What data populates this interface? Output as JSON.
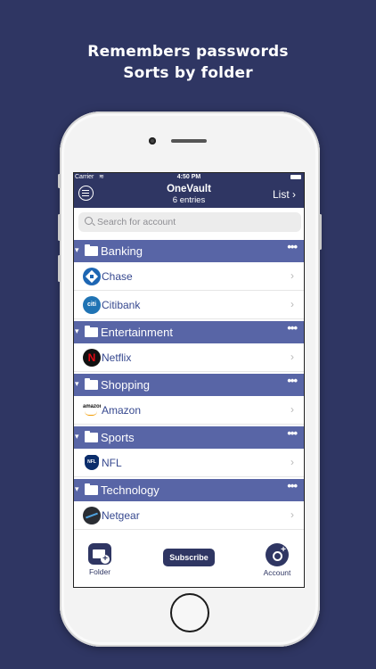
{
  "headline": {
    "line1": "Remembers passwords",
    "line2": "Sorts by folder"
  },
  "status": {
    "carrier": "Carrier",
    "time": "4:50 PM"
  },
  "nav": {
    "title": "OneVault",
    "subtitle": "6 entries",
    "list_label": "List ›"
  },
  "search": {
    "placeholder": "Search for account"
  },
  "sections": [
    {
      "name": "Banking",
      "entries": [
        "Chase",
        "Citibank"
      ]
    },
    {
      "name": "Entertainment",
      "entries": [
        "Netflix"
      ]
    },
    {
      "name": "Shopping",
      "entries": [
        "Amazon"
      ]
    },
    {
      "name": "Sports",
      "entries": [
        "NFL"
      ]
    },
    {
      "name": "Technology",
      "entries": [
        "Netgear"
      ]
    }
  ],
  "logos": {
    "citi": "citi",
    "netflix": "N",
    "amazon": "amazon",
    "nfl": "NFL"
  },
  "glyphs": {
    "triangle": "▾",
    "dots": "•••",
    "chevron": "›",
    "wifi": "≋"
  },
  "toolbar": {
    "folder_label": "Folder",
    "subscribe_label": "Subscribe",
    "account_label": "Account"
  },
  "colors": {
    "background": "#2f3663",
    "section": "#5865a6",
    "link": "#36488f"
  }
}
